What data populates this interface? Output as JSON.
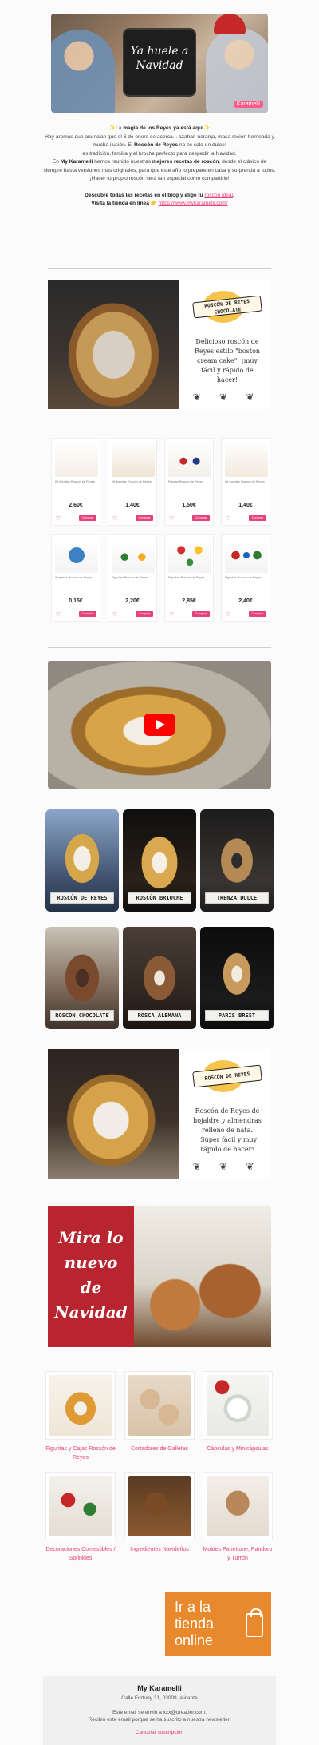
{
  "hero": {
    "title": "Ya huele a Navidad",
    "badge": "Karamelli"
  },
  "intro": {
    "p1_pre": "✨La ",
    "p1_bold": "magia de los Reyes ya está aquí",
    "p1_post": "✨",
    "p2": "Hay aromas que anuncian que el 6 de enero se acerca... azahar, naranja, masa recién horneada y mucha ilusión. El ",
    "p2_bold": "Roscón de Reyes",
    "p2_post": " no es solo un dulce:",
    "p3": "es tradición, familia y el broche perfecto para despedir la Navidad.",
    "p4_pre": "En ",
    "p4_bold1": "My Karamelli",
    "p4_mid": " hemos reunido nuestras ",
    "p4_bold2": "mejores recetas de roscón",
    "p4_post": ", desde el clásico de siempre hasta versiones más originales, para que este año lo prepare en casa y sorprenda a todos.",
    "p5": "¡Hacer tu propio roscón será tan especial como compartirlo!",
    "cta1_pre": "Descubre todas las recetas en el blog y elige tu ",
    "cta1_link": "roscón ideal",
    "cta1_post": ".",
    "cta2_pre": "Visita la tienda en línea 👉 ",
    "cta2_link": "https://www.mykaramelli.com/"
  },
  "promo1": {
    "ribbon": "ROSCÓN DE REYES CHOCOLATE",
    "desc": "Delicioso roscón de Reyes estilo \"boston cream cake\". ¡muy fácil y rápido de hacer!",
    "flourish": "❦ ❦ ❦"
  },
  "products": [
    {
      "name": "Kit figuritas Roscón de Reyes",
      "price": "2,60€",
      "buy": "Comprar"
    },
    {
      "name": "Kit figuritas Roscón de Reyes",
      "price": "1,40€",
      "buy": "Comprar"
    },
    {
      "name": "Figuras Roscón de Reyes",
      "price": "1,50€",
      "buy": "Comprar"
    },
    {
      "name": "Kit figuritas Roscón de Reyes",
      "price": "1,40€",
      "buy": "Comprar"
    },
    {
      "name": "Sorpresa Roscón de Reyes",
      "price": "0,15€",
      "buy": "Comprar"
    },
    {
      "name": "Figuritas Roscón de Reyes",
      "price": "2,20€",
      "buy": "Comprar"
    },
    {
      "name": "Figuritas Roscón de Reyes",
      "price": "2,85€",
      "buy": "Comprar"
    },
    {
      "name": "Figuritas Roscón de Reyes",
      "price": "2,40€",
      "buy": "Comprar"
    }
  ],
  "categories": [
    {
      "label": "ROSCÓN DE REYES"
    },
    {
      "label": "ROSCÓN BRIOCHE"
    },
    {
      "label": "TRENZA DULCE"
    },
    {
      "label": "ROSCÓN CHOCOLATE"
    },
    {
      "label": "ROSCA ALEMANA"
    },
    {
      "label": "PARIS BREST"
    }
  ],
  "promo2": {
    "ribbon": "ROSCÓN DE REYES",
    "desc": "Roscón de Reyes de hojaldre y almendras relleno de nata. ¡Súper fácil y muy rápido de hacer!",
    "flourish": "❦ ❦ ❦"
  },
  "xmas": {
    "line1": "Mira lo",
    "line2": "nuevo",
    "line3": "de",
    "line4": "Navidad"
  },
  "shop_categories": [
    {
      "label": "Figuritas y Cajas Roscón de Reyes"
    },
    {
      "label": "Cortadores de Galletas"
    },
    {
      "label": "Cápsulas y Minicápsulas"
    },
    {
      "label": "Decoraciones Comestibles / Sprinkles"
    },
    {
      "label": "Ingredientes Navideños"
    },
    {
      "label": "Moldes Panettone, Pandoro y Turrón"
    }
  ],
  "store": {
    "line1": "Ir a la",
    "line2": "tienda",
    "line3": "online"
  },
  "footer": {
    "name": "My Karamelli",
    "address": "Calle Fortuny 31, 03009, alicante",
    "note1": "Este email se envió a xxx@ureader.com.",
    "note2": "Recibió este email porque se ha suscrito a nuestra newsletter.",
    "unsubscribe": "Cancelar suscripción"
  },
  "colors": {
    "accent": "#e8407a",
    "orange": "#e8892d",
    "red": "#b9252f",
    "yellow": "#f6c34b"
  }
}
